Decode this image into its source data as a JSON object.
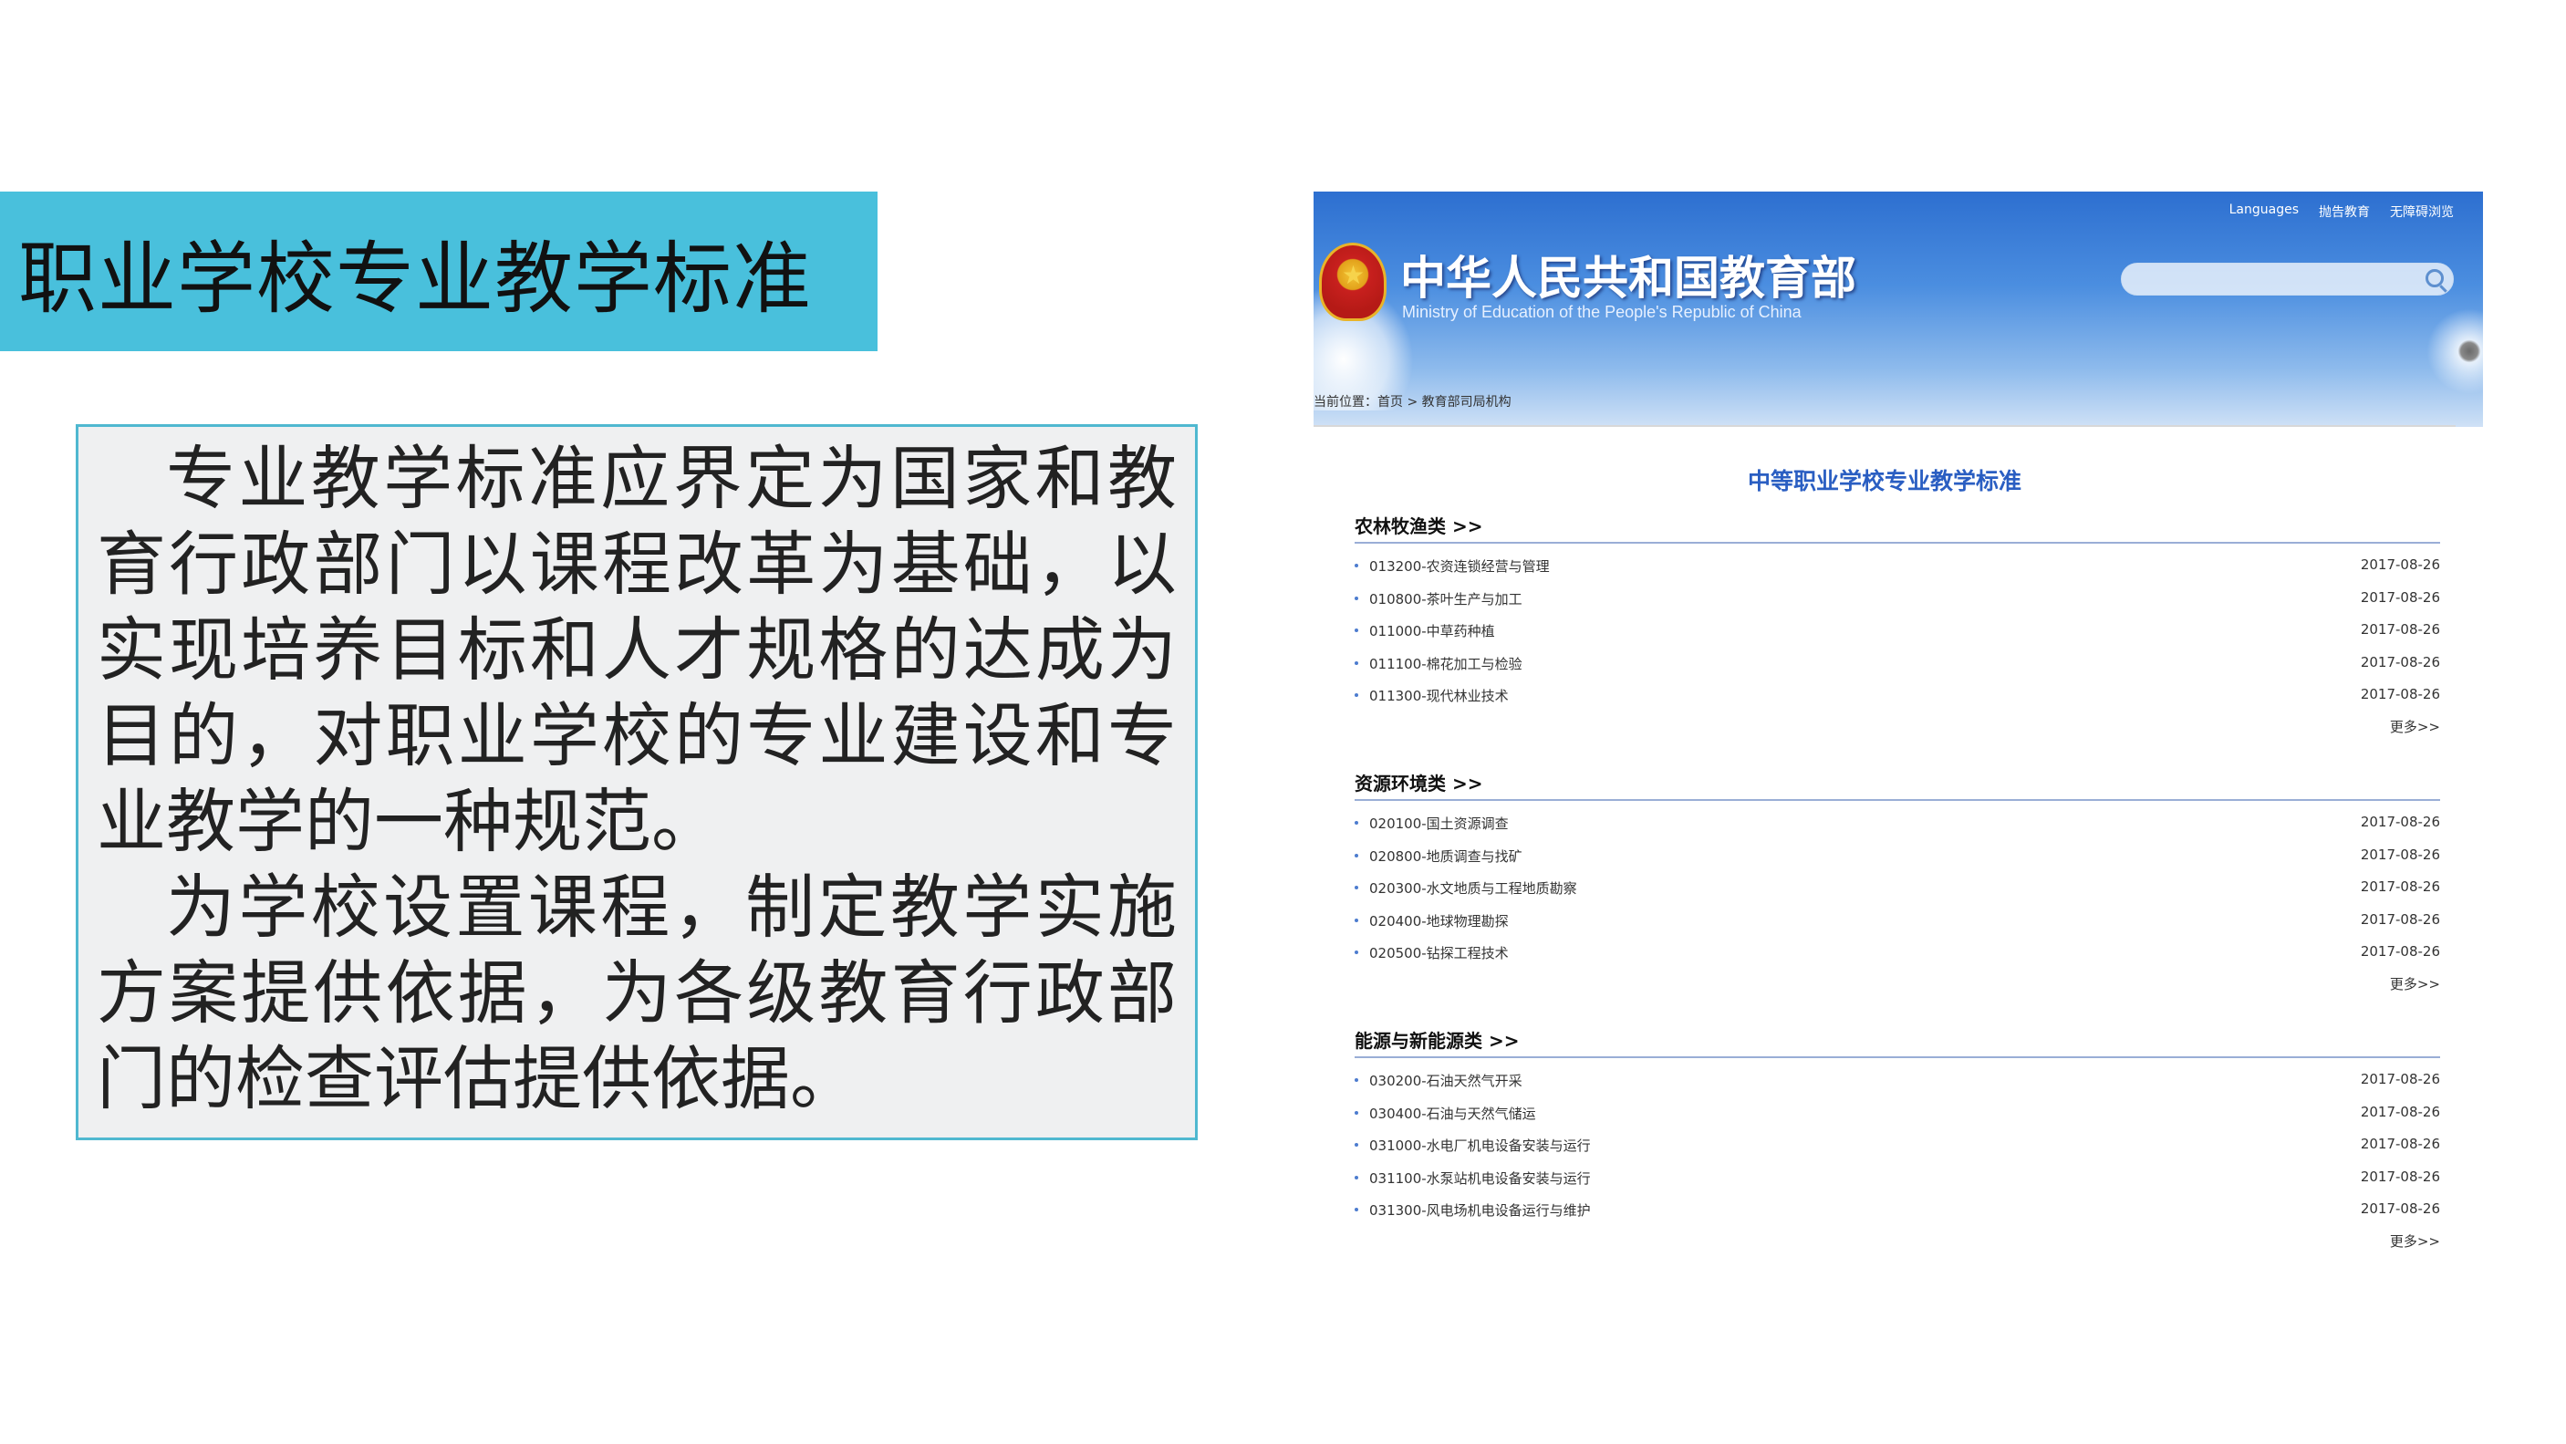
{
  "slide": {
    "title": "职业学校专业教学标准",
    "paragraphs": [
      "专业教学标准应界定为国家和教育行政部门以课程改革为基础，以实现培养目标和人才规格的达成为目的，对职业学校的专业建设和专业教学的一种规范。",
      "为学校设置课程，制定教学实施方案提供依据，为各级教育行政部门的检查评估提供依据。"
    ]
  },
  "website": {
    "site_name": "中华人民共和国教育部",
    "site_name_en": "Ministry of Education of the People's Republic of China",
    "top_links": [
      "Languages",
      "抛告教育",
      "无障碍浏览"
    ],
    "breadcrumb": "当前位置：首页 > 教育部司局机构",
    "page_heading": "中等职业学校专业教学标准",
    "more_label": "更多>>",
    "sections": [
      {
        "title": "农林牧渔类 >>",
        "items": [
          {
            "name": "013200-农资连锁经营与管理",
            "date": "2017-08-26"
          },
          {
            "name": "010800-茶叶生产与加工",
            "date": "2017-08-26"
          },
          {
            "name": "011000-中草药种植",
            "date": "2017-08-26"
          },
          {
            "name": "011100-棉花加工与检验",
            "date": "2017-08-26"
          },
          {
            "name": "011300-现代林业技术",
            "date": "2017-08-26"
          }
        ]
      },
      {
        "title": "资源环境类 >>",
        "items": [
          {
            "name": "020100-国土资源调查",
            "date": "2017-08-26"
          },
          {
            "name": "020800-地质调查与找矿",
            "date": "2017-08-26"
          },
          {
            "name": "020300-水文地质与工程地质勘察",
            "date": "2017-08-26"
          },
          {
            "name": "020400-地球物理勘探",
            "date": "2017-08-26"
          },
          {
            "name": "020500-钻探工程技术",
            "date": "2017-08-26"
          }
        ]
      },
      {
        "title": "能源与新能源类 >>",
        "items": [
          {
            "name": "030200-石油天然气开采",
            "date": "2017-08-26"
          },
          {
            "name": "030400-石油与天然气储运",
            "date": "2017-08-26"
          },
          {
            "name": "031000-水电厂机电设备安装与运行",
            "date": "2017-08-26"
          },
          {
            "name": "031100-水泵站机电设备安装与运行",
            "date": "2017-08-26"
          },
          {
            "name": "031300-风电场机电设备运行与维护",
            "date": "2017-08-26"
          }
        ]
      }
    ]
  },
  "colors": {
    "banner": "#49c0dc",
    "text_box_bg": "#eff0f1",
    "text_box_border": "#4fb8d0",
    "site_heading": "#2a5ec2"
  }
}
